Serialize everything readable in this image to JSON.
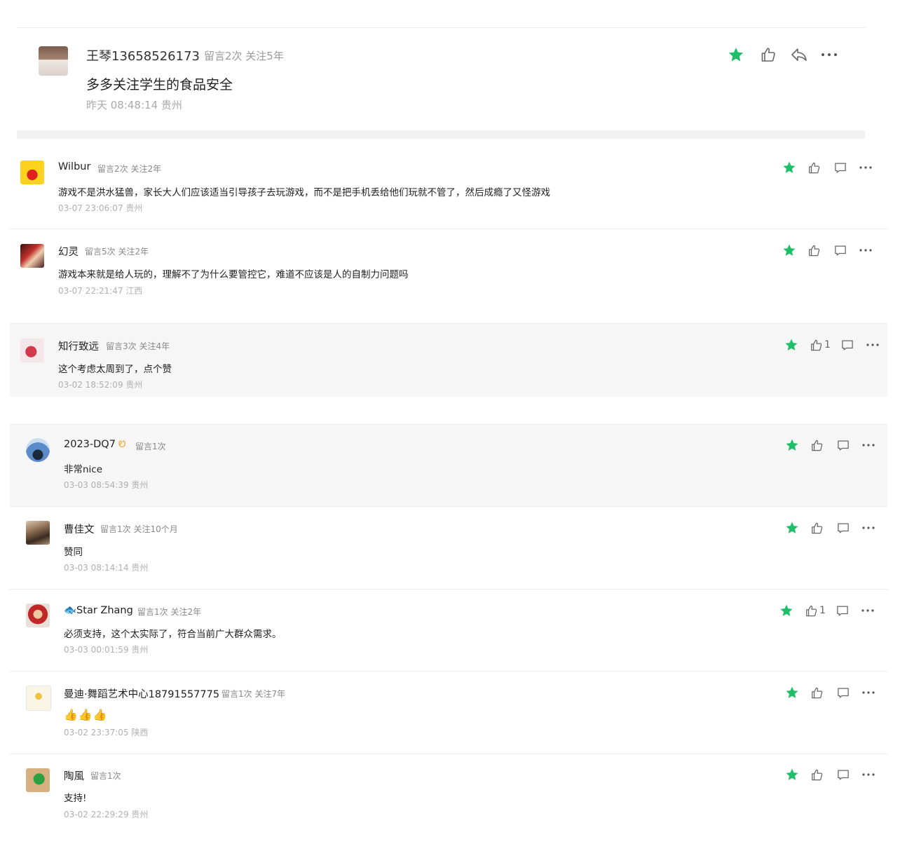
{
  "main_comment": {
    "author": "王琴13658526173",
    "meta": "留言2次 关注5年",
    "text": "多多关注学生的食品安全",
    "time": "昨天 08:48:14 贵州"
  },
  "replies": [
    {
      "author": "Wilbur",
      "meta": "留言2次 关注2年",
      "text": "游戏不是洪水猛兽，家长大人们应该适当引导孩子去玩游戏，而不是把手机丢给他们玩就不管了，然后成瘾了又怪游戏",
      "time": "03-07 23:06:07 贵州",
      "likes": ""
    },
    {
      "author": "幻灵",
      "meta": "留言5次 关注2年",
      "text": "游戏本来就是给人玩的，理解不了为什么要管控它，难道不应该是人的自制力问题吗",
      "time": "03-07 22:21:47 江西",
      "likes": ""
    },
    {
      "author": "知行致远",
      "meta": "留言3次 关注4年",
      "text": "这个考虑太周到了，点个赞",
      "time": "03-02 18:52:09 贵州",
      "likes": "1"
    },
    {
      "author": "2023-DQ7",
      "meta": "留言1次",
      "text": "非常nice",
      "time": "03-03 08:54:39 贵州",
      "likes": ""
    },
    {
      "author": "曹佳文",
      "meta": "留言1次 关注10个月",
      "text": "赞同",
      "time": "03-03 08:14:14 贵州",
      "likes": ""
    },
    {
      "author": "🐟Star Zhang",
      "meta": "留言1次 关注2年",
      "text": "必须支持，这个太实际了，符合当前广大群众需求。",
      "time": "03-03 00:01:59 贵州",
      "likes": "1"
    },
    {
      "author": "曼迪·舞蹈艺术中心18791557775",
      "meta": "留言1次 关注7年",
      "text": "👍👍👍",
      "time": "03-02 23:37:05 陕西",
      "likes": ""
    },
    {
      "author": "陶風",
      "meta": "留言1次",
      "text": "支持!",
      "time": "03-02 22:29:29 贵州",
      "likes": ""
    }
  ],
  "icons": {
    "star_color": "#1fbf6a",
    "icon_color": "#666666"
  }
}
